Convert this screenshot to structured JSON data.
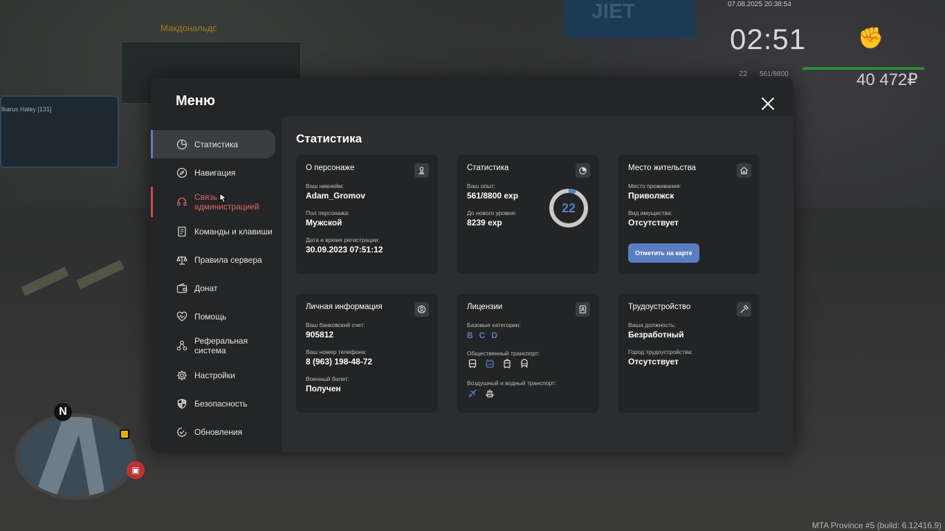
{
  "background": {
    "shop_sign": "Макдональдс",
    "bus_label": "Ikarus Haley [131]",
    "billboard": "JIET"
  },
  "hud": {
    "datetime": "07.08.2025 20:38:54",
    "clock": "02:51",
    "level": "22",
    "exp": "561/8800",
    "money": "40 472₽",
    "compass": "N",
    "build": "MTA Province #5 (build: 6.12416.9)"
  },
  "menu": {
    "title": "Меню",
    "sidebar": [
      {
        "label": "Статистика",
        "icon": "pie-chart-icon",
        "active": true
      },
      {
        "label": "Навигация",
        "icon": "compass-icon"
      },
      {
        "label": "Связь с администрацией",
        "icon": "headset-icon",
        "alert": true
      },
      {
        "label": "Команды и клавиши",
        "icon": "document-icon"
      },
      {
        "label": "Правила сервера",
        "icon": "scales-icon"
      },
      {
        "label": "Донат",
        "icon": "wallet-icon"
      },
      {
        "label": "Помощь",
        "icon": "heart-icon"
      },
      {
        "label": "Реферальная система",
        "icon": "network-icon"
      },
      {
        "label": "Настройки",
        "icon": "gear-icon"
      },
      {
        "label": "Безопасность",
        "icon": "shield-icon"
      },
      {
        "label": "Обновления",
        "icon": "check-circle-icon"
      }
    ]
  },
  "content": {
    "title": "Статистика",
    "character": {
      "title": "О персонаже",
      "nickname_label": "Ваш никнейм:",
      "nickname": "Adam_Gromov",
      "gender_label": "Пол персонажа:",
      "gender": "Мужской",
      "reg_label": "Дата и время регистрации:",
      "reg": "30.09.2023 07:51:12"
    },
    "stats": {
      "title": "Статистика",
      "exp_label": "Ваш опыт:",
      "exp": "561/8800 exp",
      "next_label": "До нового уровня:",
      "next": "8239 exp",
      "level": "22",
      "level_progress": 0.064
    },
    "residence": {
      "title": "Место жительства",
      "place_label": "Место проживания:",
      "place": "Приволжск",
      "property_label": "Вид имущества:",
      "property": "Отсутствует",
      "map_button": "Отметить на карте"
    },
    "personal": {
      "title": "Личная информация",
      "bank_label": "Ваш банковский счет:",
      "bank": "905812",
      "phone_label": "Ваш номер телефона:",
      "phone": "8 (963) 198-48-72",
      "military_label": "Военный билет:",
      "military": "Получен"
    },
    "licenses": {
      "title": "Лицензии",
      "base_label": "Базовые категории:",
      "categories": [
        "B",
        "C",
        "D"
      ],
      "public_label": "Общественный транспорт:",
      "air_label": "Воздушный и водный транспорт:"
    },
    "employment": {
      "title": "Трудоустройство",
      "position_label": "Ваша должность:",
      "position": "Безработный",
      "city_label": "Город трудоустройства:",
      "city": "Отсутствует"
    }
  }
}
